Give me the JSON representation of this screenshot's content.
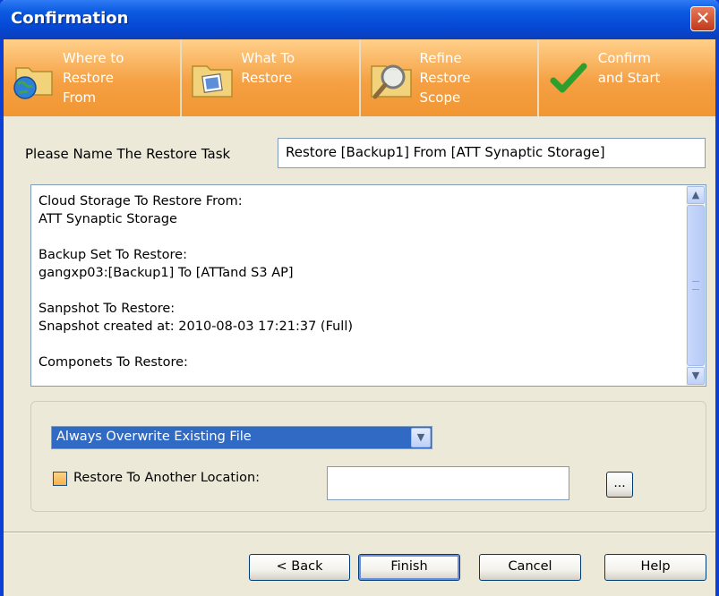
{
  "window": {
    "title": "Confirmation",
    "close_symbol": "✕"
  },
  "steps": [
    {
      "label_lines": [
        "Where to",
        "Restore",
        "From"
      ],
      "icon": "folder-globe-icon"
    },
    {
      "label_lines": [
        "What To",
        "Restore"
      ],
      "icon": "folder-image-icon"
    },
    {
      "label_lines": [
        "Refine",
        "Restore",
        "Scope"
      ],
      "icon": "magnifier-icon"
    },
    {
      "label_lines": [
        "Confirm",
        "and Start"
      ],
      "icon": "checkmark-icon"
    }
  ],
  "task": {
    "label": "Please Name The  Restore Task",
    "value": "Restore [Backup1] From [ATT Synaptic Storage]"
  },
  "summary": {
    "sections": [
      {
        "heading": "Cloud Storage To Restore From:",
        "value": "ATT Synaptic Storage"
      },
      {
        "heading": "Backup Set To Restore:",
        "value": "gangxp03:[Backup1] To [ATTand S3 AP]"
      },
      {
        "heading": "Sanpshot To Restore:",
        "value": "Snapshot created at: 2010-08-03 17:21:37 (Full)"
      },
      {
        "heading": "Componets To Restore:",
        "value": ""
      }
    ]
  },
  "options": {
    "overwrite_selected": "Always Overwrite Existing File",
    "restore_location_label": "Restore To Another Location:",
    "restore_location_value": "",
    "browse_label": "...",
    "restore_location_checked": false
  },
  "buttons": {
    "back": "< Back",
    "finish": "Finish",
    "cancel": "Cancel",
    "help": "Help"
  },
  "colors": {
    "titlebar": "#0548D4",
    "step_bar": "#F5A043",
    "dialog_bg": "#ECE9D8",
    "selection": "#316AC5"
  }
}
